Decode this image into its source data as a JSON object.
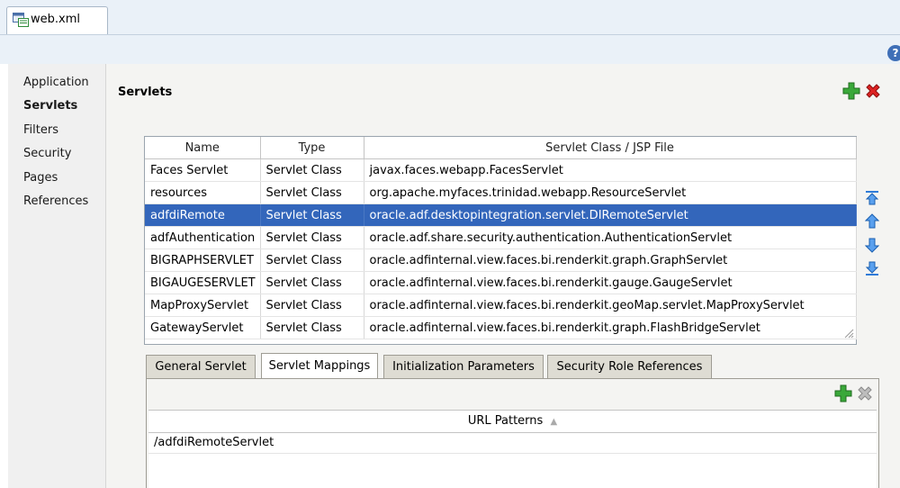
{
  "file_tab": {
    "label": "web.xml"
  },
  "help": {
    "label": "?"
  },
  "nav": {
    "items": [
      {
        "label": "Application"
      },
      {
        "label": "Servlets",
        "selected": true
      },
      {
        "label": "Filters"
      },
      {
        "label": "Security"
      },
      {
        "label": "Pages"
      },
      {
        "label": "References"
      }
    ]
  },
  "section": {
    "title": "Servlets"
  },
  "servlet_table": {
    "columns": [
      "Name",
      "Type",
      "Servlet Class / JSP File"
    ],
    "rows": [
      [
        "Faces Servlet",
        "Servlet Class",
        "javax.faces.webapp.FacesServlet"
      ],
      [
        "resources",
        "Servlet Class",
        "org.apache.myfaces.trinidad.webapp.ResourceServlet"
      ],
      [
        "adfdiRemote",
        "Servlet Class",
        "oracle.adf.desktopintegration.servlet.DIRemoteServlet"
      ],
      [
        "adfAuthentication",
        "Servlet Class",
        "oracle.adf.share.security.authentication.AuthenticationServlet"
      ],
      [
        "BIGRAPHSERVLET",
        "Servlet Class",
        "oracle.adfinternal.view.faces.bi.renderkit.graph.GraphServlet"
      ],
      [
        "BIGAUGESERVLET",
        "Servlet Class",
        "oracle.adfinternal.view.faces.bi.renderkit.gauge.GaugeServlet"
      ],
      [
        "MapProxyServlet",
        "Servlet Class",
        "oracle.adfinternal.view.faces.bi.renderkit.geoMap.servlet.MapProxyServlet"
      ],
      [
        "GatewayServlet",
        "Servlet Class",
        "oracle.adfinternal.view.faces.bi.renderkit.graph.FlashBridgeServlet"
      ]
    ],
    "selected_row": 2
  },
  "detail_tabs": [
    {
      "label": "General Servlet"
    },
    {
      "label": "Servlet Mappings",
      "selected": true
    },
    {
      "label": "Initialization Parameters"
    },
    {
      "label": "Security Role References"
    }
  ],
  "mappings": {
    "column": "URL Patterns",
    "sort_glyph": "▲",
    "rows": [
      "/adfdiRemoteServlet"
    ]
  },
  "colors": {
    "selection": "#3366bb",
    "add_icon": "#2e9b2e",
    "delete_icon": "#d62020",
    "arrow_icon": "#2f7bd8"
  },
  "icons": [
    "file-xml-icon",
    "help-icon",
    "add-icon",
    "delete-icon",
    "move-top-icon",
    "move-up-icon",
    "move-down-icon",
    "move-bottom-icon",
    "resize-grip-icon"
  ]
}
